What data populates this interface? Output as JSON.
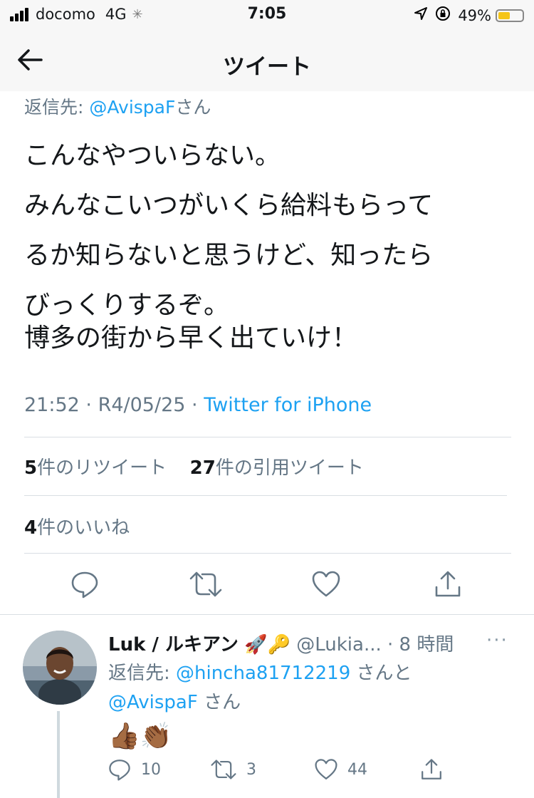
{
  "status_bar": {
    "carrier": "docomo",
    "network": "4G",
    "time": "7:05",
    "battery_percent": "49%",
    "battery_level": 0.49
  },
  "nav": {
    "title": "ツイート"
  },
  "tweet": {
    "reply_to_label": "返信先:",
    "reply_to_handle": "@AvispaF",
    "reply_to_suffix": "さん",
    "text_lines": [
      "こんなやついらない。",
      "みんなこいつがいくら給料もらって",
      "るか知らないと思うけど、知ったら",
      "びっくりするぞ。"
    ],
    "text_para2": "博多の街から早く出ていけ！",
    "time": "21:52",
    "date": "R4/05/25",
    "source": "Twitter for iPhone",
    "retweets_count": "5",
    "retweets_label": "件のリツイート",
    "quotes_count": "27",
    "quotes_label": "件の引用ツイート",
    "likes_count": "4",
    "likes_label": "件のいいね",
    "actions": [
      "reply-icon",
      "retweet-icon",
      "like-icon",
      "share-icon"
    ]
  },
  "reply": {
    "name": "Luk / ルキアン",
    "handle": "@Lukia...",
    "time": "· 8 時間",
    "more": "···",
    "reply_to_label": "返信先:",
    "reply_to_handle1": "@hincha81712219",
    "reply_to_join": "さんと",
    "reply_to_handle2": "@AvispaF",
    "reply_to_suffix": "さん",
    "body": "👍🏾👏🏾",
    "reply_count": "10",
    "retweet_count": "3",
    "like_count": "44"
  },
  "colors": {
    "link": "#1da1f2",
    "secondary_text": "#657786",
    "primary_text": "#14171a",
    "divider": "#d9dee3",
    "bar_background": "#f7f7f7"
  }
}
